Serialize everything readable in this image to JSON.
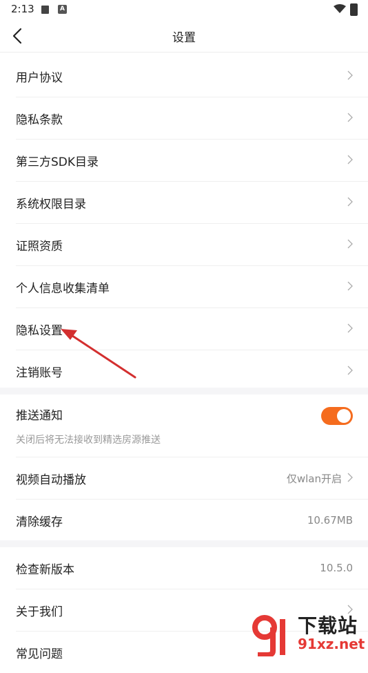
{
  "status_bar": {
    "time": "2:13",
    "icon_a": "book-icon",
    "icon_b_text": "A"
  },
  "header": {
    "title": "设置",
    "back_icon": "back-arrow-icon"
  },
  "group1": {
    "items": [
      {
        "label": "用户协议"
      },
      {
        "label": "隐私条款"
      },
      {
        "label": "第三方SDK目录"
      },
      {
        "label": "系统权限目录"
      },
      {
        "label": "证照资质"
      },
      {
        "label": "个人信息收集清单"
      },
      {
        "label": "隐私设置"
      },
      {
        "label": "注销账号"
      }
    ]
  },
  "group2": {
    "push": {
      "label": "推送通知",
      "sub": "关闭后将无法接收到精选房源推送",
      "enabled": true
    },
    "video": {
      "label": "视频自动播放",
      "value": "仅wlan开启"
    },
    "cache": {
      "label": "清除缓存",
      "value": "10.67MB"
    }
  },
  "group3": {
    "version": {
      "label": "检查新版本",
      "value": "10.5.0"
    },
    "about": {
      "label": "关于我们"
    },
    "faq": {
      "label": "常见问题"
    }
  },
  "watermark": {
    "title": "下载站",
    "url": "91xz.net"
  },
  "colors": {
    "accent": "#f56c1e",
    "arrow": "#d32f2f"
  }
}
